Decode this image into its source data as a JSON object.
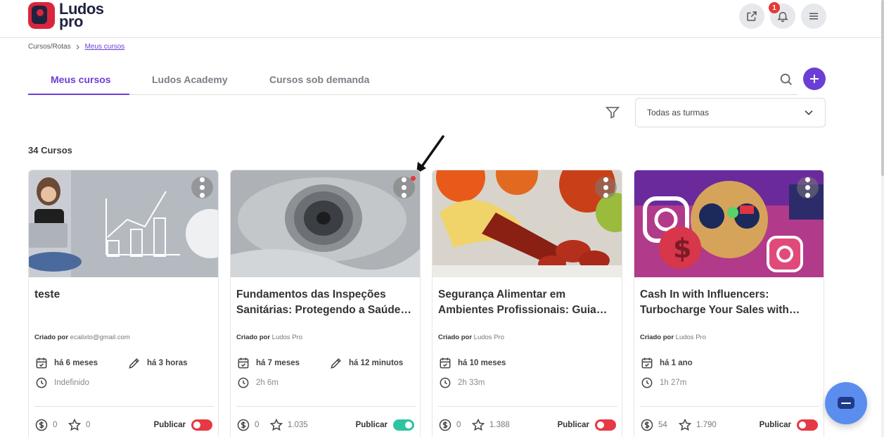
{
  "brand": {
    "line1": "Ludos",
    "line2": "pro"
  },
  "header": {
    "notifications_count": "1"
  },
  "breadcrumb": {
    "parent": "Cursos/Rotas",
    "current": "Meus cursos"
  },
  "tabs": [
    {
      "label": "Meus cursos",
      "active": true
    },
    {
      "label": "Ludos Academy",
      "active": false
    },
    {
      "label": "Cursos sob demanda",
      "active": false
    }
  ],
  "filter": {
    "selected": "Todas as turmas"
  },
  "course_count": "34 Cursos",
  "cards": [
    {
      "title": "teste",
      "creator_label": "Criado por",
      "creator": "ecalixto@gmail.com",
      "created": "há 6 meses",
      "edited": "há 3 horas",
      "duration": "Indefinido",
      "price": "0",
      "rating": "0",
      "publish_label": "Publicar",
      "published": false,
      "accent": "#d9dde3"
    },
    {
      "title": "Fundamentos das Inspeções Sanitárias: Protegendo a Saúde Pública",
      "creator_label": "Criado por",
      "creator": "Ludos Pro",
      "created": "há 7 meses",
      "edited": "há 12 minutos",
      "duration": "2h 6m",
      "price": "0",
      "rating": "1.035",
      "publish_label": "Publicar",
      "published": true,
      "accent": "#b8bcc2"
    },
    {
      "title": "Segurança Alimentar em Ambientes Profissionais: Guia Completo",
      "creator_label": "Criado por",
      "creator": "Ludos Pro",
      "created": "há 10 meses",
      "edited": "",
      "duration": "2h 33m",
      "price": "0",
      "rating": "1.388",
      "publish_label": "Publicar",
      "published": false,
      "accent": "#e8b04a"
    },
    {
      "title": "Cash In with Influencers: Turbocharge Your Sales with Social Media",
      "creator_label": "Criado por",
      "creator": "Ludos Pro",
      "created": "há 1 ano",
      "edited": "",
      "duration": "1h 27m",
      "price": "54",
      "rating": "1.790",
      "publish_label": "Publicar",
      "published": false,
      "accent": "#e0457b"
    }
  ]
}
